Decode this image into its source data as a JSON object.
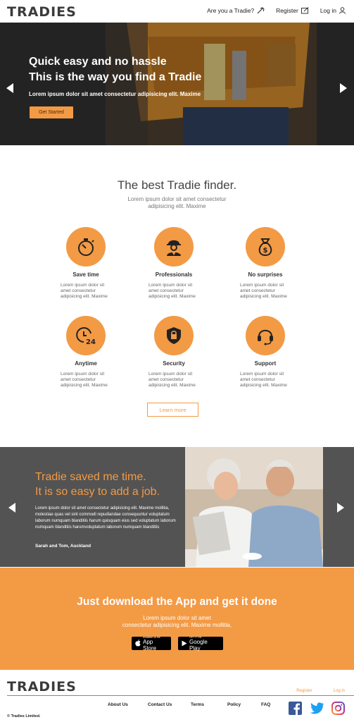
{
  "header": {
    "logo": "TRADIES",
    "nav": {
      "tradie_label": "Are you a Tradie?",
      "register_label": "Register",
      "login_label": "Log in"
    }
  },
  "hero": {
    "title_line1": "Quick easy and no hassle",
    "title_line2": "This is the way you find a Tradie",
    "subtitle": "Lorem ipsum dolor sit amet consectetur adipisicing elit. Maxime",
    "cta_label": "Get Started"
  },
  "features": {
    "title": "The best Tradie finder.",
    "subtitle_line1": "Lorem ipsum dolor sit amet consectetur",
    "subtitle_line2": "adipisicing elit. Maxime",
    "items": [
      {
        "icon": "stopwatch-icon",
        "title": "Save time",
        "desc": "Lorem ipsum dolor sit amet consectetur adipisicing elit. Maxime"
      },
      {
        "icon": "worker-icon",
        "title": "Professionals",
        "desc": "Lorem ipsum dolor sit amet consectetur adipisicing elit. Maxime"
      },
      {
        "icon": "money-bag-icon",
        "title": "No surprises",
        "desc": "Lorem ipsum dolor sit amet consectetur adipisicing elit. Maxime"
      },
      {
        "icon": "clock-24-icon",
        "title": "Anytime",
        "desc": "Lorem ipsum dolor sit amet consectetur adipisicing elit. Maxime"
      },
      {
        "icon": "shield-lock-icon",
        "title": "Security",
        "desc": "Lorem ipsum dolor sit amet consectetur adipisicing elit. Maxime"
      },
      {
        "icon": "headset-icon",
        "title": "Support",
        "desc": "Lorem ipsum dolor sit amet consectetur adipisicing elit. Maxime"
      }
    ],
    "learn_more_label": "Learn more"
  },
  "testimonial": {
    "title_line1": "Tradie saved me time.",
    "title_line2": "It is so easy to add a job.",
    "body": "Lorem ipsum dolor sit amet consectetur adipisicing elit. Maxime mollitia,  molestiae quas vel sint commodi repudiandae consequuntur voluptatum laborum  numquam blanditiis harum quisquam eius sed  voluptatum laborum  numquam blanditiis harumvoluptatum laborum  numquam blanditiis",
    "author": "Sarah and  Tom, Auckland"
  },
  "app": {
    "title": "Just download the App and get it done",
    "sub_line1": "Lorem ipsum dolor sit amet",
    "sub_line2": "consectetur adipisicing  elit. Maxime mollitia,",
    "appstore_small": "Available on the",
    "appstore_big": "App Store",
    "googleplay_small": "GET IT ON",
    "googleplay_big": "Google Play"
  },
  "footer": {
    "logo": "TRADIES",
    "register_label": "Register",
    "login_label": "Log in",
    "links": [
      "About Us",
      "Contact Us",
      "Terms",
      "Policy",
      "FAQ"
    ],
    "copyright": "© Tradies Limited."
  },
  "colors": {
    "accent": "#f39a45",
    "dark": "#535353",
    "facebook": "#3b5998",
    "twitter": "#1da1f2"
  }
}
